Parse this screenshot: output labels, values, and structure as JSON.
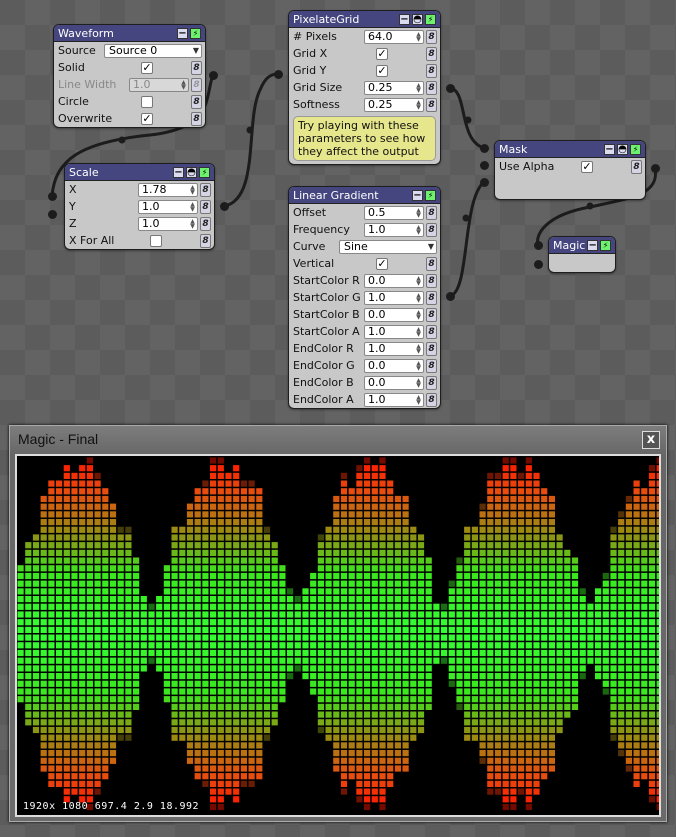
{
  "nodes": [
    {
      "id": "waveform",
      "title": "Waveform",
      "buttons": [
        "minimize",
        "power"
      ],
      "rows": [
        {
          "label": "Source",
          "type": "dropdown",
          "value": "Source 0"
        },
        {
          "label": "Solid",
          "type": "check",
          "checked": true
        },
        {
          "label": "Line Width",
          "type": "number",
          "value": "1.0",
          "disabled": true
        },
        {
          "label": "Circle",
          "type": "check",
          "checked": false
        },
        {
          "label": "Overwrite",
          "type": "check",
          "checked": true
        }
      ]
    },
    {
      "id": "scale",
      "title": "Scale",
      "buttons": [
        "minimize",
        "preview",
        "power"
      ],
      "rows": [
        {
          "label": "X",
          "type": "number",
          "value": "1.78"
        },
        {
          "label": "Y",
          "type": "number",
          "value": "1.0"
        },
        {
          "label": "Z",
          "type": "number",
          "value": "1.0"
        },
        {
          "label": "X For All",
          "type": "check",
          "checked": false
        }
      ]
    },
    {
      "id": "pixelate",
      "title": "PixelateGrid",
      "buttons": [
        "minimize",
        "preview",
        "power"
      ],
      "rows": [
        {
          "label": "# Pixels",
          "type": "number",
          "value": "64.0"
        },
        {
          "label": "Grid X",
          "type": "check",
          "checked": true
        },
        {
          "label": "Grid Y",
          "type": "check",
          "checked": true
        },
        {
          "label": "Grid Size",
          "type": "number",
          "value": "0.25"
        },
        {
          "label": "Softness",
          "type": "number",
          "value": "0.25"
        }
      ],
      "tooltip": "Try playing with these parameters to see how they affect the output"
    },
    {
      "id": "gradient",
      "title": "Linear Gradient",
      "buttons": [
        "minimize",
        "power"
      ],
      "rows": [
        {
          "label": "Offset",
          "type": "number",
          "value": "0.5"
        },
        {
          "label": "Frequency",
          "type": "number",
          "value": "1.0"
        },
        {
          "label": "Curve",
          "type": "dropdown",
          "value": "Sine"
        },
        {
          "label": "Vertical",
          "type": "check",
          "checked": true
        },
        {
          "label": "StartColor R",
          "type": "number",
          "value": "0.0"
        },
        {
          "label": "StartColor G",
          "type": "number",
          "value": "1.0"
        },
        {
          "label": "StartColor B",
          "type": "number",
          "value": "0.0"
        },
        {
          "label": "StartColor A",
          "type": "number",
          "value": "1.0"
        },
        {
          "label": "EndColor R",
          "type": "number",
          "value": "1.0"
        },
        {
          "label": "EndColor G",
          "type": "number",
          "value": "0.0"
        },
        {
          "label": "EndColor B",
          "type": "number",
          "value": "0.0"
        },
        {
          "label": "EndColor A",
          "type": "number",
          "value": "1.0"
        }
      ]
    },
    {
      "id": "mask",
      "title": "Mask",
      "buttons": [
        "minimize",
        "preview",
        "power"
      ],
      "rows": [
        {
          "label": "Use Alpha",
          "type": "check",
          "checked": true
        }
      ]
    },
    {
      "id": "magic",
      "title": "Magic",
      "buttons": [
        "minimize",
        "power"
      ],
      "rows": []
    }
  ],
  "output_window": {
    "title": "Magic - Final",
    "close_label": "x",
    "stats": "1920x 1080 697.4 2.9 18.992",
    "colors": {
      "start": "#00ff00",
      "end": "#ff0000"
    }
  }
}
